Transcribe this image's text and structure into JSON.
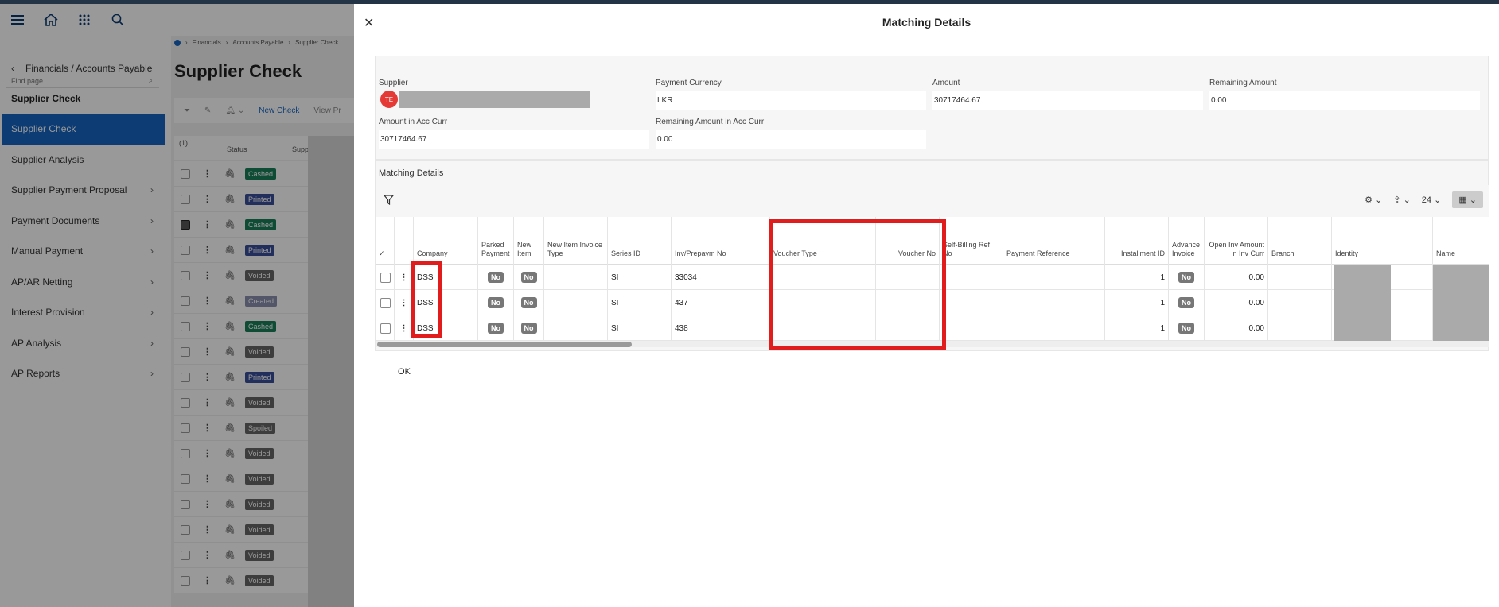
{
  "app": {
    "find_page_placeholder": "Find page",
    "nav_crumb": "Financials / Accounts Payable",
    "section_title": "Supplier Check",
    "nav_items": [
      {
        "label": "Supplier Check",
        "active": true,
        "chevron": false
      },
      {
        "label": "Supplier Analysis",
        "active": false,
        "chevron": false
      },
      {
        "label": "Supplier Payment Proposal",
        "active": false,
        "chevron": true
      },
      {
        "label": "Payment Documents",
        "active": false,
        "chevron": true
      },
      {
        "label": "Manual Payment",
        "active": false,
        "chevron": true
      },
      {
        "label": "AP/AR Netting",
        "active": false,
        "chevron": true
      },
      {
        "label": "Interest Provision",
        "active": false,
        "chevron": true
      },
      {
        "label": "AP Analysis",
        "active": false,
        "chevron": true
      },
      {
        "label": "AP Reports",
        "active": false,
        "chevron": true
      }
    ]
  },
  "main": {
    "breadcrumb": [
      "Financials",
      "Accounts Payable",
      "Supplier Check"
    ],
    "page_title": "Supplier Check",
    "toolbar": {
      "new_check": "New Check",
      "view": "View Pr"
    },
    "header": {
      "count": "(1)",
      "status": "Status",
      "supplier": "Supplier"
    },
    "status_rows": [
      "Cashed",
      "Printed",
      "Cashed",
      "Printed",
      "Voided",
      "Created",
      "Cashed",
      "Voided",
      "Printed",
      "Voided",
      "Spoiled",
      "Voided",
      "Voided",
      "Voided",
      "Voided",
      "Voided",
      "Voided"
    ]
  },
  "modal": {
    "title": "Matching Details",
    "supplier": {
      "label": "Supplier",
      "avatar": "TE"
    },
    "payment_currency": {
      "label": "Payment Currency",
      "value": "LKR"
    },
    "amount": {
      "label": "Amount",
      "value": "30717464.67"
    },
    "remaining_amount": {
      "label": "Remaining Amount",
      "value": "0.00"
    },
    "amount_acc_curr": {
      "label": "Amount in Acc Curr",
      "value": "30717464.67"
    },
    "remaining_acc_curr": {
      "label": "Remaining Amount in Acc Curr",
      "value": "0.00"
    },
    "details_title": "Matching Details",
    "page_size": "24",
    "columns": {
      "company": "Company",
      "parked": "Parked Payment",
      "new_item": "New Item",
      "new_item_type": "New Item Invoice Type",
      "series": "Series ID",
      "inv_no": "Inv/Prepaym No",
      "voucher_type": "Voucher Type",
      "voucher_no": "Voucher No",
      "self_billing": "Self-Billing Ref No",
      "payment_ref": "Payment Reference",
      "installment": "Installment ID",
      "advance": "Advance Invoice",
      "open_amount": "Open Inv Amount in Inv Curr",
      "branch": "Branch",
      "identity": "Identity",
      "name": "Name"
    },
    "rows": [
      {
        "company": "DSS",
        "parked": "No",
        "new_item": "No",
        "series": "SI",
        "inv_no": "33034",
        "installment": "1",
        "advance": "No",
        "open_amount": "0.00"
      },
      {
        "company": "DSS",
        "parked": "No",
        "new_item": "No",
        "series": "SI",
        "inv_no": "437",
        "installment": "1",
        "advance": "No",
        "open_amount": "0.00"
      },
      {
        "company": "DSS",
        "parked": "No",
        "new_item": "No",
        "series": "SI",
        "inv_no": "438",
        "installment": "1",
        "advance": "No",
        "open_amount": "0.00"
      }
    ],
    "ok_label": "OK"
  },
  "colors": {
    "accent": "#1565c0",
    "highlight": "#e01c1c",
    "avatar": "#e53935"
  }
}
